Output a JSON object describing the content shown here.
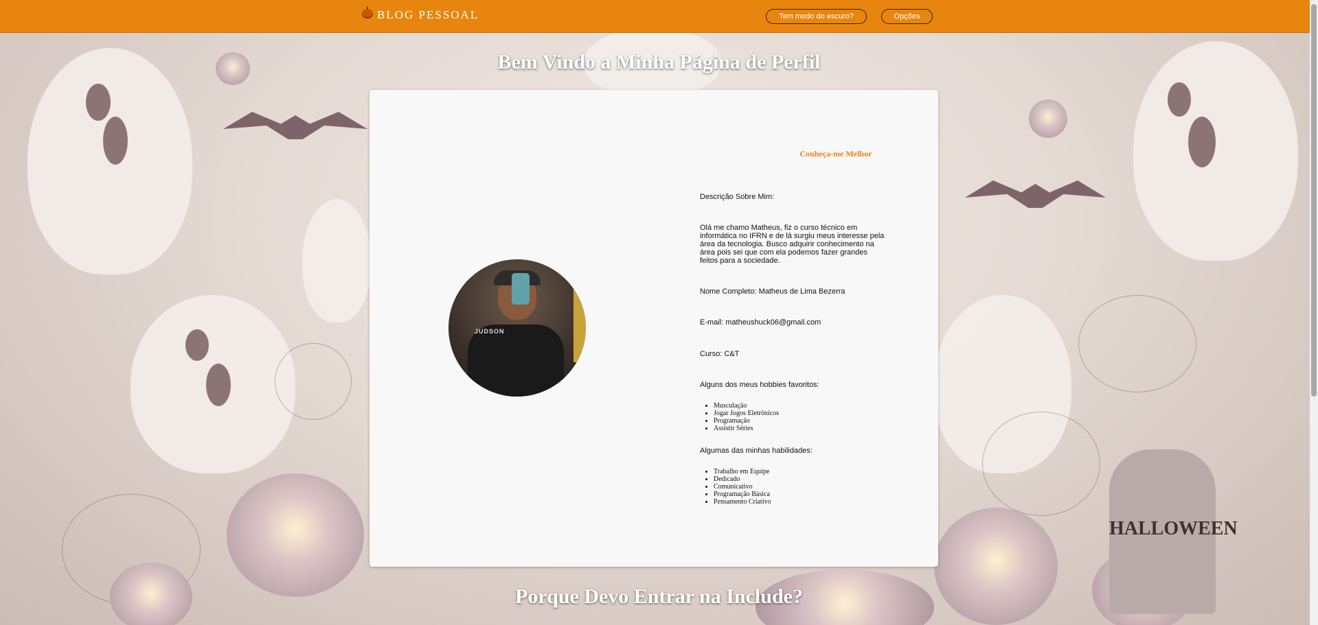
{
  "header": {
    "brand": "BLOG PESSOAL",
    "brand_icon": "pumpkin-icon",
    "dark_mode_button": "Tem medo do escuro?",
    "options_button": "Opções",
    "accent_color": "#e8850e"
  },
  "page": {
    "title": "Bem Vindo a Minha Página de Perfil",
    "next_section_title": "Porque Devo Entrar na Include?"
  },
  "profile": {
    "avatar_alt": "Foto de perfil",
    "about_title": "Conheça-me Melhor",
    "description_label": "Descrição Sobre Mim:",
    "description_text": "Olá me chamo Matheus, fiz o curso técnico em informática no IFRN e de lá surgiu meus interesse pela área da tecnologia. Busco adquirir conhecimento na área pois sei que com ela podemos fazer grandes feitos para a sociedade.",
    "full_name": "Nome Completo: Matheus de Lima Bezerra",
    "email": "E-mail: matheushuck06@gmail.com",
    "course": "Curso: C&T",
    "hobbies_label": "Alguns dos meus hobbies favoritos:",
    "hobbies": [
      "Musculação",
      "Jogar Jogos Eletrônicos",
      "Programação",
      "Assistir Séries"
    ],
    "skills_label": "Algumas das minhas habilidades:",
    "skills": [
      "Trabalho em Equipe",
      "Dedicado",
      "Comunicativo",
      "Programação Básica",
      "Pensamento Criativo"
    ]
  },
  "background": {
    "theme": "halloween",
    "tombstone_text": "HALLOWEEN"
  }
}
